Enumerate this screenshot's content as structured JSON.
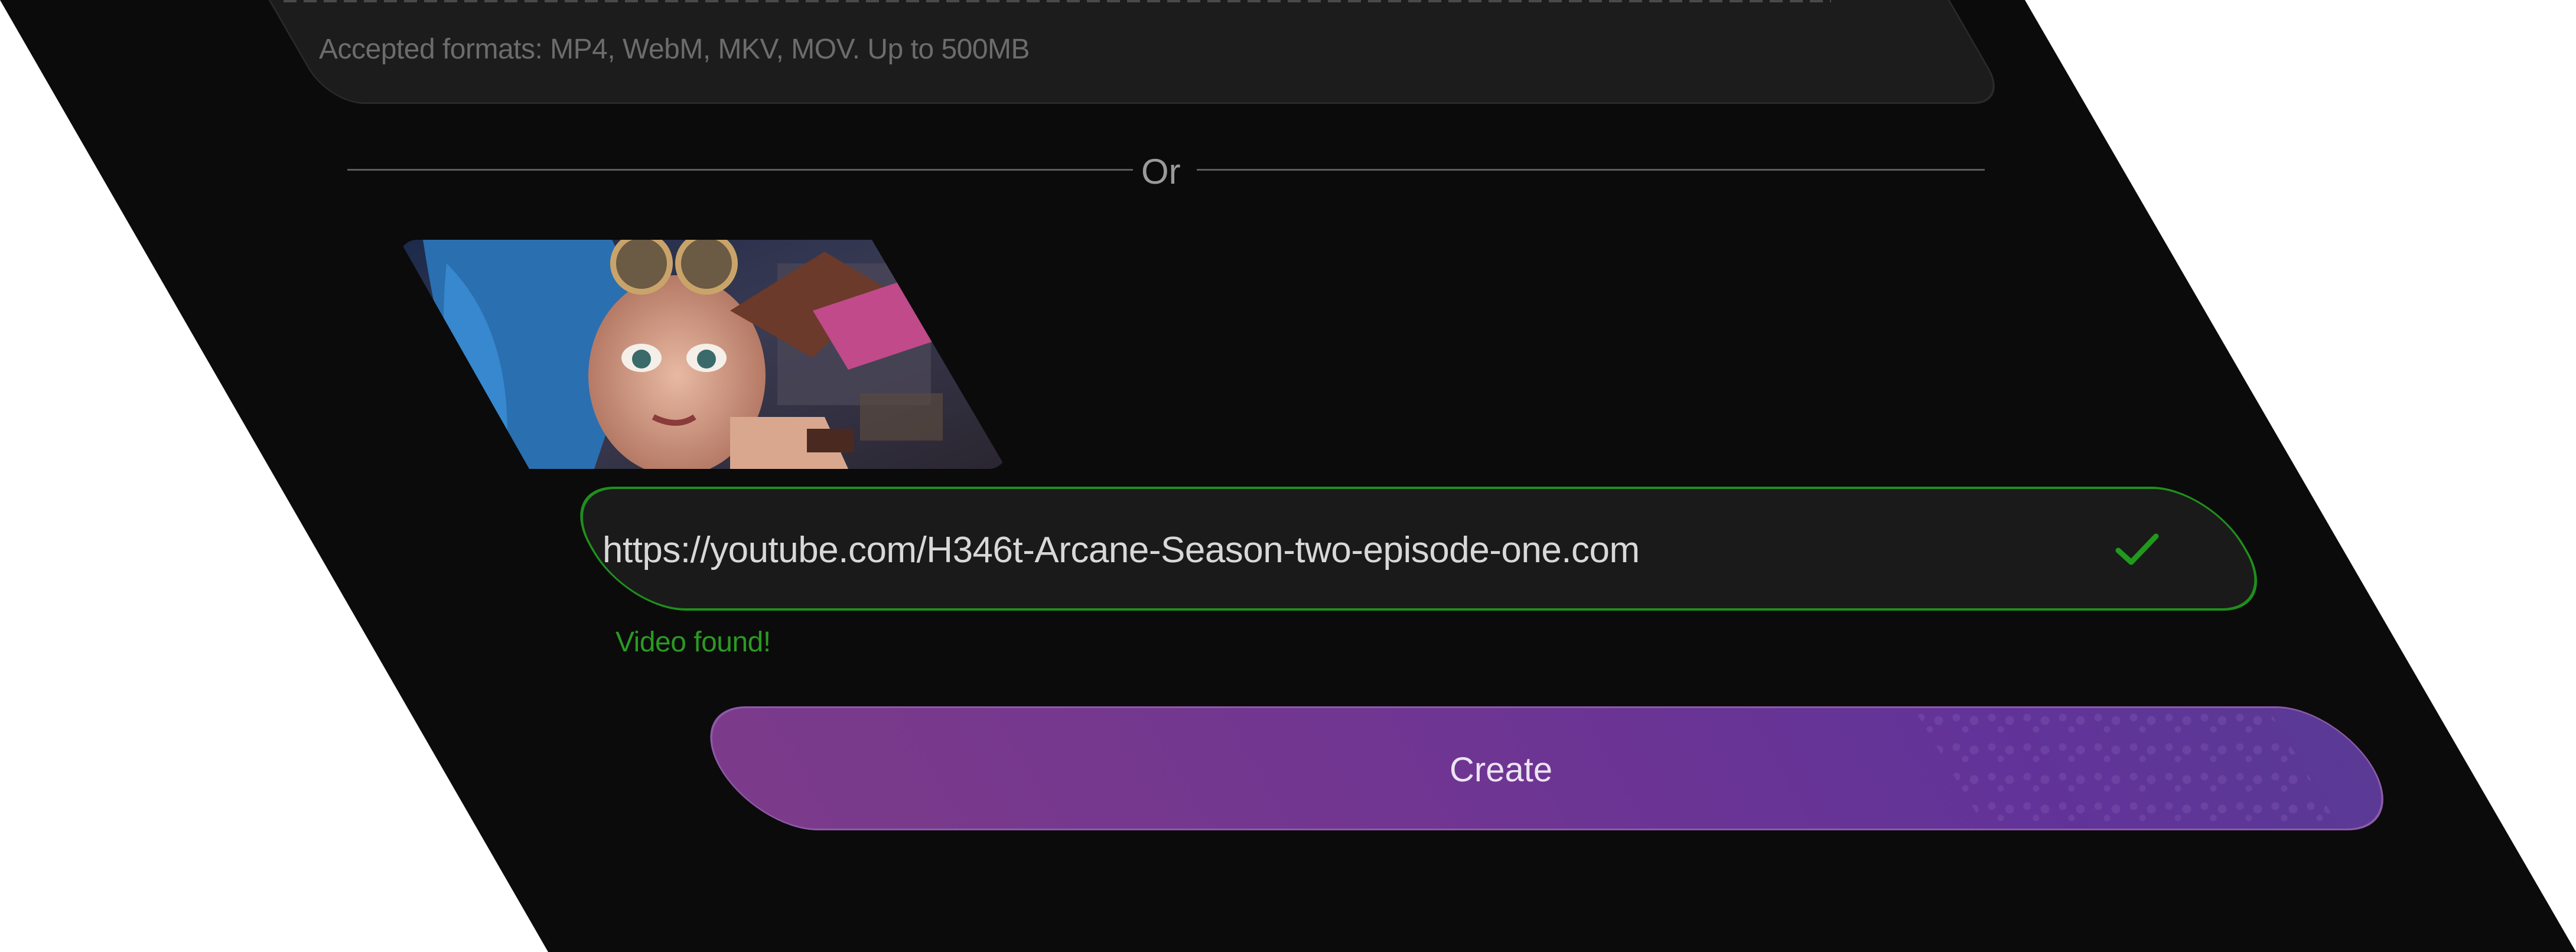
{
  "upload": {
    "formats_text": "Accepted formats: MP4, WebM, MKV, MOV. Up to 500MB"
  },
  "divider": {
    "label": "Or"
  },
  "video": {
    "url": "https://youtube.com/H346t-Arcane-Season-two-episode-one.com",
    "status": "Video found!",
    "thumbnail_icon": "video-thumbnail"
  },
  "actions": {
    "create_label": "Create"
  },
  "colors": {
    "background": "#0b0b0b",
    "field_border_valid": "#1f8f1c",
    "status_valid": "#2a9a22",
    "button_gradient_start": "#7c3b8a",
    "button_gradient_end": "#5a3a95"
  },
  "icons": {
    "valid": "check-icon"
  }
}
